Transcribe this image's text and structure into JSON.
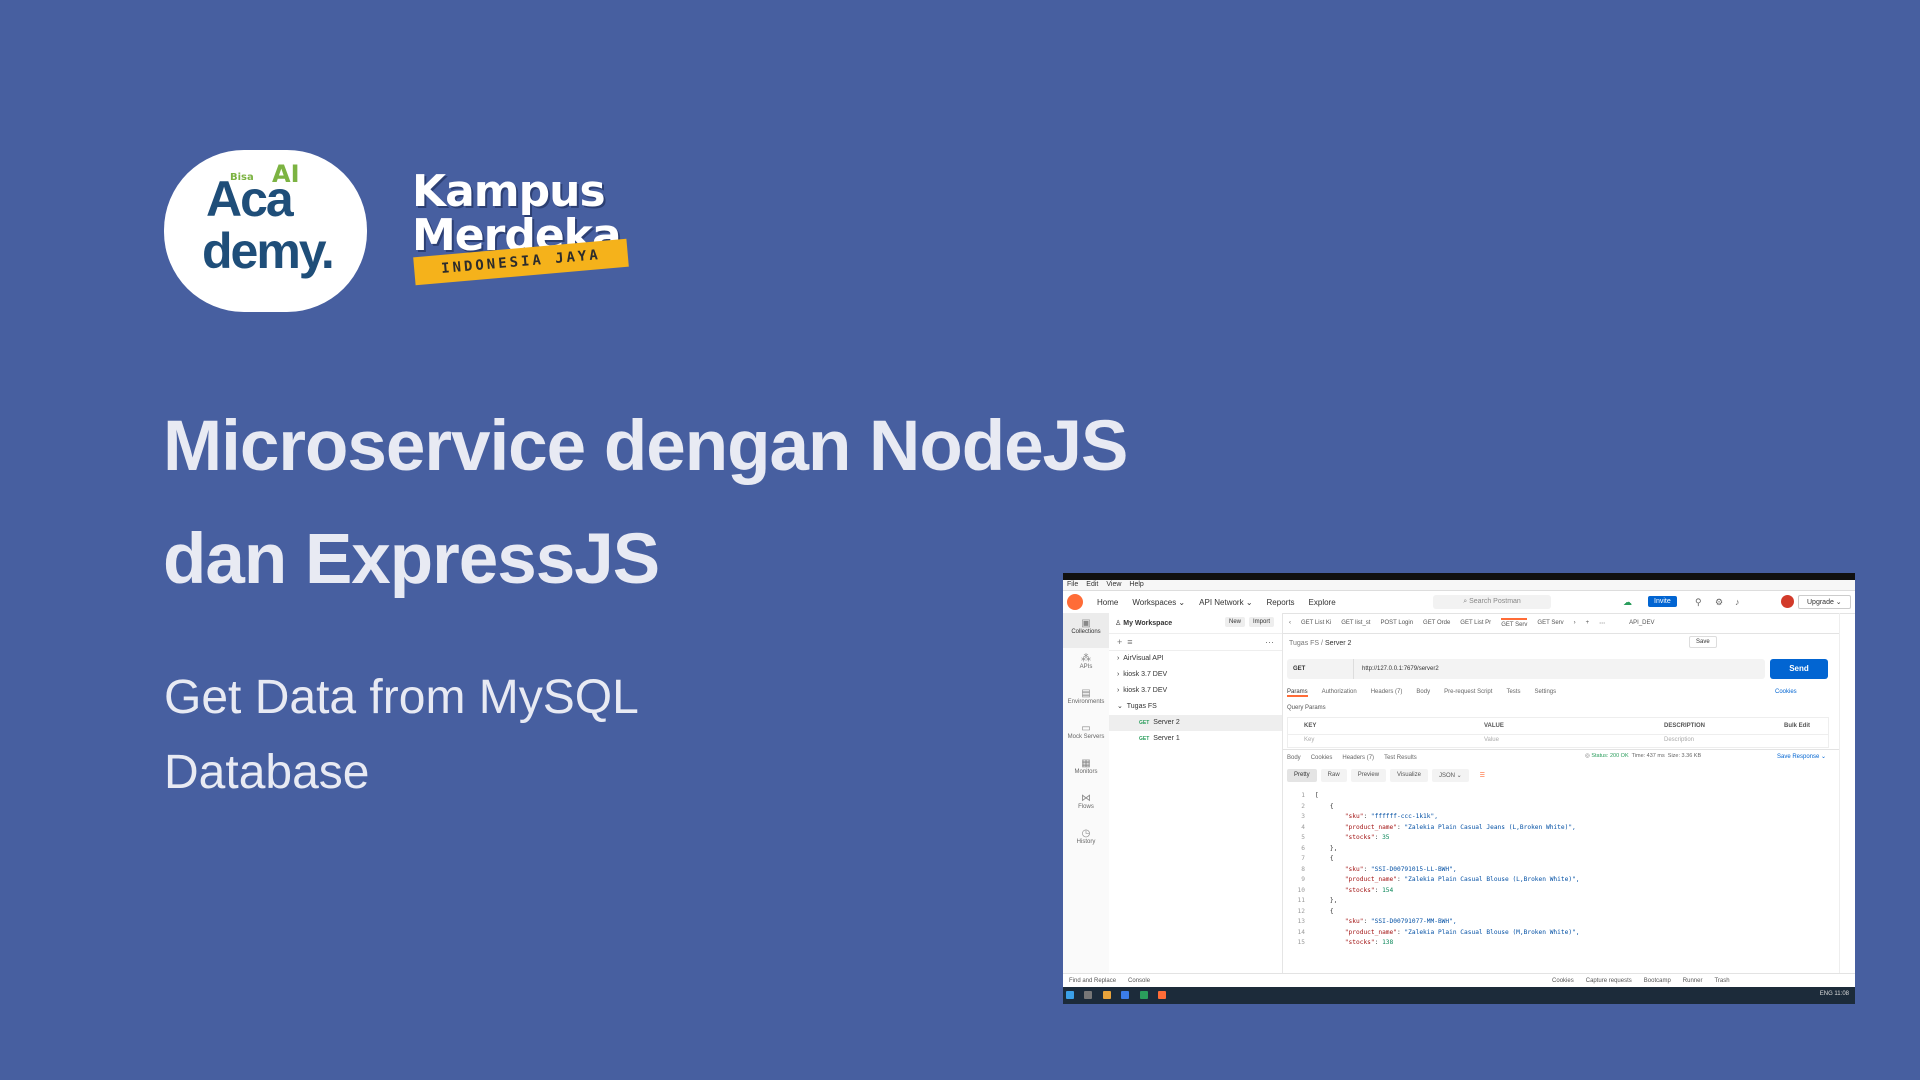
{
  "slide": {
    "logo_academy": {
      "tag": "Bisa",
      "ai": "AI",
      "line1": "Aca",
      "line2": "demy."
    },
    "logo_kampus": {
      "line1": "Kampus",
      "line2": "Merdeka",
      "band": "INDONESIA JAYA"
    },
    "title_line1": "Microservice dengan NodeJS",
    "title_line2": "dan ExpressJS",
    "subtitle_line1": "Get Data from MySQL",
    "subtitle_line2": "Database"
  },
  "postman": {
    "menu": [
      "File",
      "Edit",
      "View",
      "Help"
    ],
    "nav": [
      "Home",
      "Workspaces ⌄",
      "API Network ⌄",
      "Reports",
      "Explore"
    ],
    "search_placeholder": "Search Postman",
    "invite": "Invite",
    "upgrade": "Upgrade ⌄",
    "workspace": "My Workspace",
    "btn_new": "New",
    "btn_import": "Import",
    "rail": [
      "Collections",
      "APIs",
      "Environments",
      "Mock Servers",
      "Monitors",
      "Flows",
      "History"
    ],
    "tree": [
      {
        "label": "AirVisual API",
        "prefix": "›"
      },
      {
        "label": "kiosk 3.7 DEV",
        "prefix": "›"
      },
      {
        "label": "kiosk 3.7 DEV",
        "prefix": "›"
      },
      {
        "label": "Tugas FS",
        "prefix": "⌄"
      }
    ],
    "requests": [
      {
        "method": "GET",
        "label": "Server 2"
      },
      {
        "method": "GET",
        "label": "Server 1"
      }
    ],
    "tabs": [
      "GET List Ki",
      "GET list_st",
      "POST Login",
      "GET Orde",
      "GET List Pr",
      "GET Serv",
      "GET Serv"
    ],
    "env": "API_DEV",
    "breadcrumb_parent": "Tugas FS",
    "breadcrumb_current": "Server 2",
    "save": "Save",
    "method": "GET",
    "url": "http://127.0.0.1:7679/server2",
    "send": "Send",
    "request_tabs": [
      "Params",
      "Authorization",
      "Headers (7)",
      "Body",
      "Pre-request Script",
      "Tests",
      "Settings"
    ],
    "cookies": "Cookies",
    "query_params": "Query Params",
    "kv_headers": [
      "KEY",
      "VALUE",
      "DESCRIPTION",
      "Bulk Edit"
    ],
    "kv_placeholders": [
      "Key",
      "Value",
      "Description"
    ],
    "response_tabs": [
      "Body",
      "Cookies",
      "Headers (7)",
      "Test Results"
    ],
    "status": "Status: 200 OK",
    "time": "Time: 437 ms",
    "size": "Size: 3.36 KB",
    "save_response": "Save Response ⌄",
    "view_modes": [
      "Pretty",
      "Raw",
      "Preview",
      "Visualize",
      "JSON ⌄"
    ],
    "code_lines": [
      {
        "n": "1",
        "t": "["
      },
      {
        "n": "2",
        "t": "    {"
      },
      {
        "n": "3",
        "k": "\"sku\"",
        "v": "\"ffffff-ccc-1k1k\","
      },
      {
        "n": "4",
        "k": "\"product_name\"",
        "v": "\"Zalekia Plain Casual Jeans (L,Broken White)\","
      },
      {
        "n": "5",
        "k": "\"stocks\"",
        "num": "35"
      },
      {
        "n": "6",
        "t": "    },"
      },
      {
        "n": "7",
        "t": "    {"
      },
      {
        "n": "8",
        "k": "\"sku\"",
        "v": "\"SSI-D00791015-LL-BWH\","
      },
      {
        "n": "9",
        "k": "\"product_name\"",
        "v": "\"Zalekia Plain Casual Blouse (L,Broken White)\","
      },
      {
        "n": "10",
        "k": "\"stocks\"",
        "num": "154"
      },
      {
        "n": "11",
        "t": "    },"
      },
      {
        "n": "12",
        "t": "    {"
      },
      {
        "n": "13",
        "k": "\"sku\"",
        "v": "\"SSI-D00791077-MM-BWH\","
      },
      {
        "n": "14",
        "k": "\"product_name\"",
        "v": "\"Zalekia Plain Casual Blouse (M,Broken White)\","
      },
      {
        "n": "15",
        "k": "\"stocks\"",
        "num": "138"
      }
    ],
    "statusbar": [
      "Find and Replace",
      "Console",
      "Cookies",
      "Capture requests",
      "Bootcamp",
      "Runner",
      "Trash"
    ],
    "taskbar_right": "ENG  11:08"
  }
}
